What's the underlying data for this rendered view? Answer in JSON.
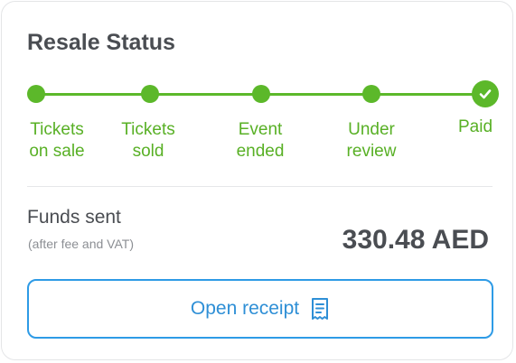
{
  "title": "Resale Status",
  "colors": {
    "progress": "#5cb82a",
    "accent": "#2e9be6",
    "text": "#4a4d52",
    "muted": "#8c8f94"
  },
  "steps": [
    {
      "line1": "Tickets",
      "line2": "on sale",
      "state": "complete"
    },
    {
      "line1": "Tickets",
      "line2": "sold",
      "state": "complete"
    },
    {
      "line1": "Event",
      "line2": "ended",
      "state": "complete"
    },
    {
      "line1": "Under",
      "line2": "review",
      "state": "complete"
    },
    {
      "line1": "Paid",
      "line2": "",
      "state": "current",
      "icon": "check-icon"
    }
  ],
  "funds": {
    "label": "Funds sent",
    "note": "(after fee and VAT)",
    "amount": "330.48 AED"
  },
  "receipt_button": {
    "label": "Open receipt",
    "icon": "receipt-icon"
  }
}
